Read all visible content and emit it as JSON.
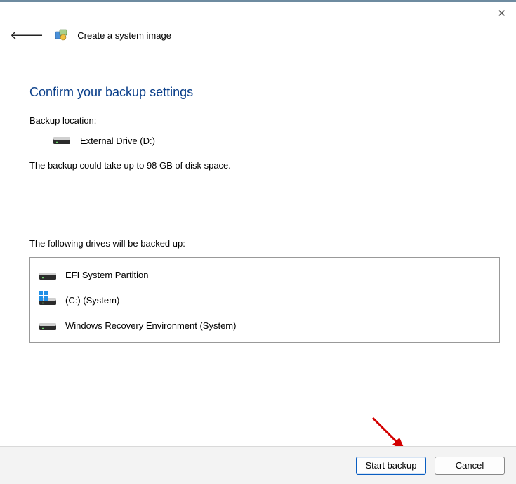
{
  "window": {
    "title": "Create a system image"
  },
  "heading": "Confirm your backup settings",
  "backup_location_label": "Backup location:",
  "backup_location_value": "External Drive (D:)",
  "size_note": "The backup could take up to 98 GB of disk space.",
  "drives_label": "The following drives will be backed up:",
  "drives": [
    {
      "name": "EFI System Partition",
      "icon": "drive"
    },
    {
      "name": "(C:) (System)",
      "icon": "drive-windows"
    },
    {
      "name": "Windows Recovery Environment (System)",
      "icon": "drive"
    }
  ],
  "buttons": {
    "start": "Start backup",
    "cancel": "Cancel"
  }
}
